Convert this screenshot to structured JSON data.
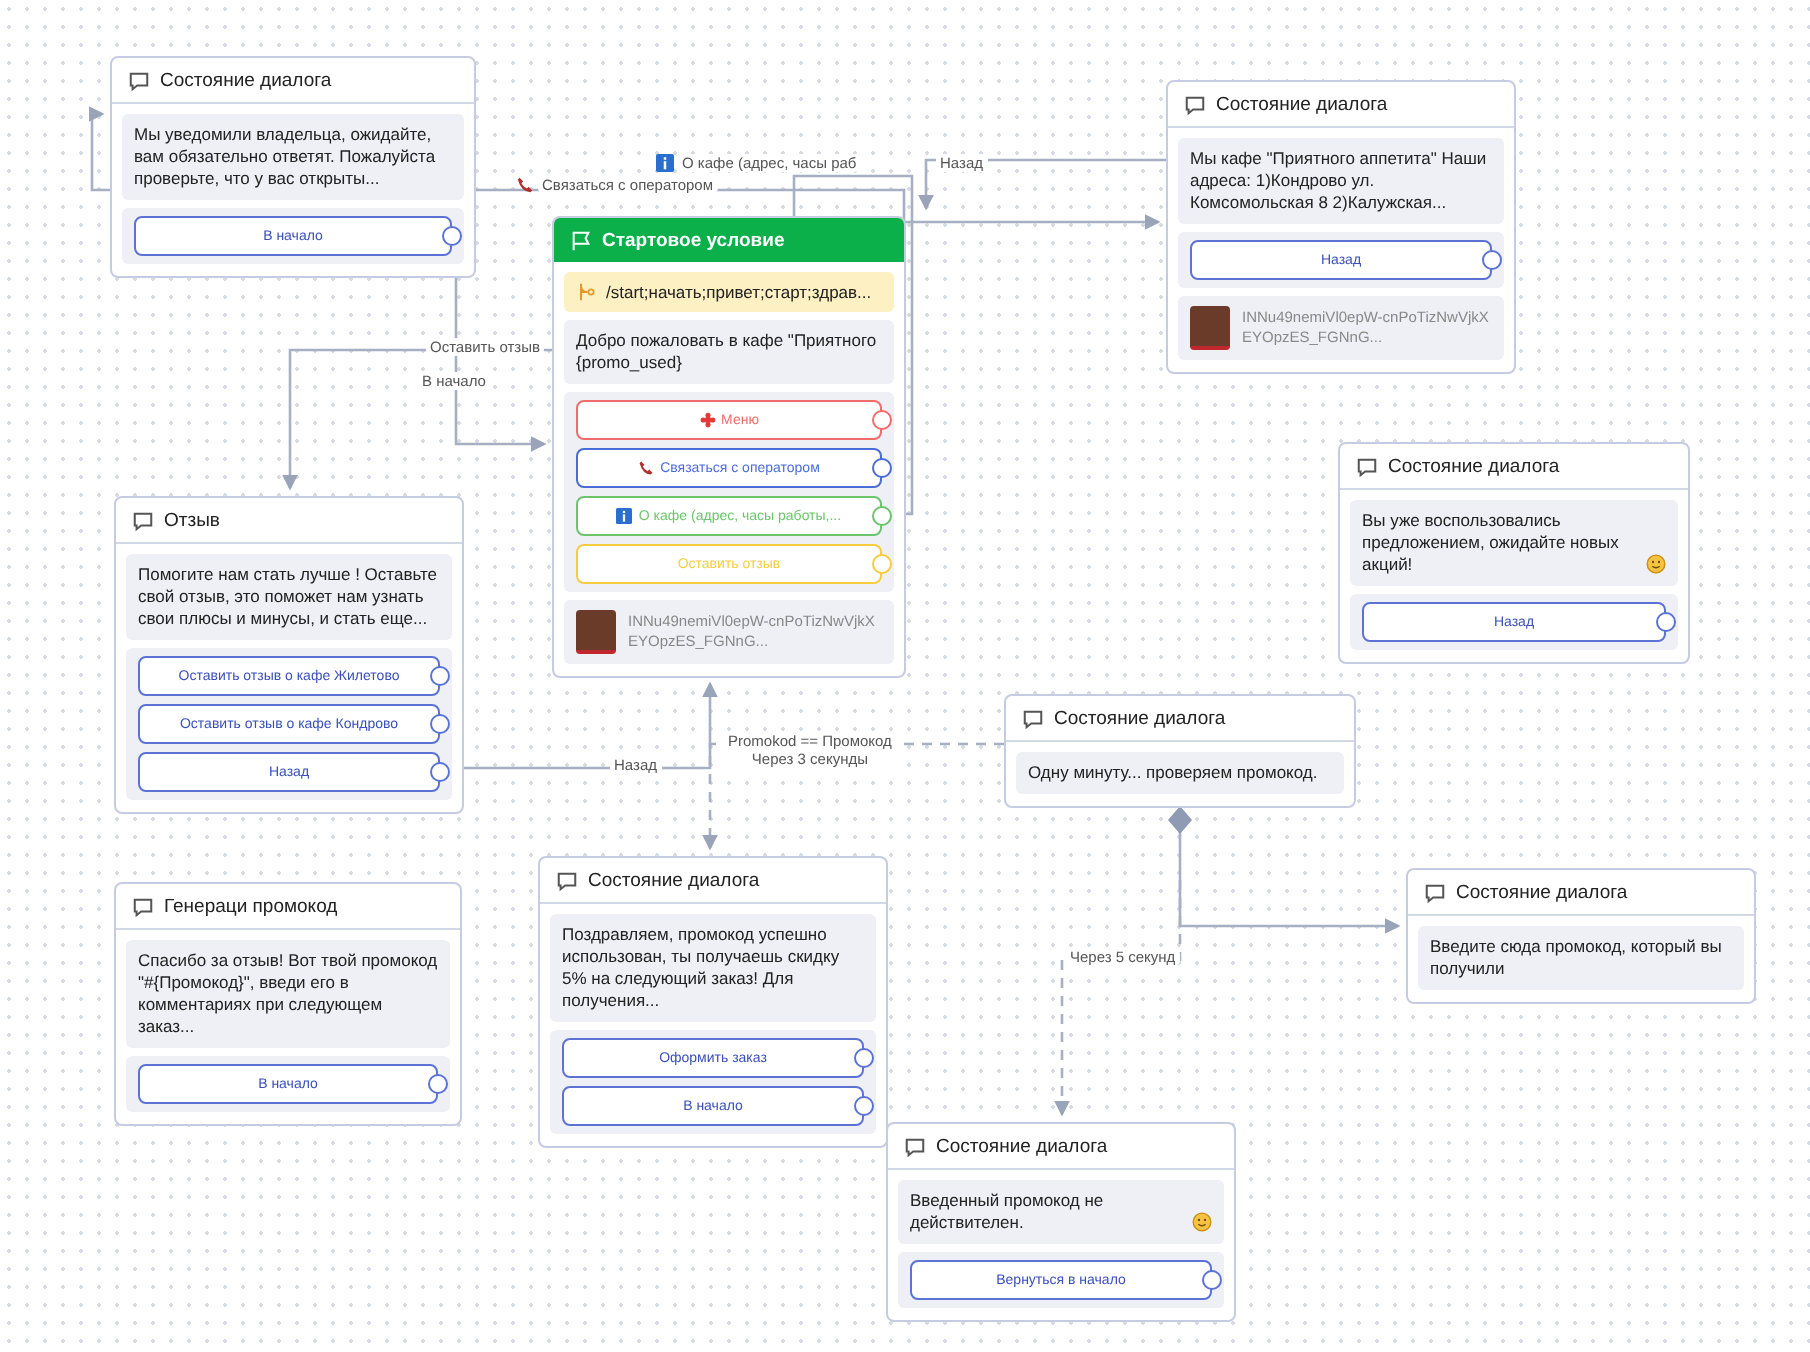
{
  "nodes": [
    {
      "kind": "dialog",
      "title": "Состояние диалога",
      "message": "Мы уведомили владельца, ожидайте, вам обязательно ответят. Пожалуйста проверьте, что у вас открыты...",
      "emoji": false,
      "buttons": [
        {
          "label": "В начало"
        }
      ]
    },
    {
      "kind": "start",
      "title": "Стартовое условие",
      "trigger": "/start;начать;привет;старт;здрав...",
      "message": "Добро пожаловать в кафе \"Приятного {promo_used}",
      "emoji": false,
      "buttons": [
        {
          "label": "Меню",
          "color": "#f26b6b"
        },
        {
          "label": "Связаться с оператором",
          "color": "#4a6cd6"
        },
        {
          "label": "О кафе (адрес, часы работы,...",
          "color": "#6cc56c"
        },
        {
          "label": "Оставить отзыв",
          "color": "#f7cd3f"
        }
      ],
      "media": "INNu49nemiVl0epW-cnPoTizNwVjkXEYOpzES_FGNnG..."
    },
    {
      "kind": "dialog",
      "title": "Состояние диалога",
      "message": "Мы кафе \"Приятного аппетита\" Наши адреса: 1)Кондрово ул. Комсомольская 8 2)Калужская...",
      "emoji": false,
      "buttons": [
        {
          "label": "Назад"
        }
      ],
      "media": "INNu49nemiVl0epW-cnPoTizNwVjkXEYOpzES_FGNnG..."
    },
    {
      "kind": "dialog",
      "title": "Состояние диалога",
      "message": "Вы уже воспользовались предложением, ожидайте новых акций!",
      "emoji": true,
      "buttons": [
        {
          "label": "Назад"
        }
      ]
    },
    {
      "kind": "dialog",
      "title": "Отзыв",
      "message": "Помогите нам стать лучше ! Оставьте свой отзыв, это поможет нам узнать свои плюсы и минусы, и стать еще...",
      "emoji": false,
      "buttons": [
        {
          "label": "Оставить отзыв о кафе Жилетово"
        },
        {
          "label": "Оставить отзыв о кафе Кондрово"
        },
        {
          "label": "Назад"
        }
      ]
    },
    {
      "kind": "dialog",
      "title": "Состояние диалога",
      "message": "Одну минуту... проверяем промокод.",
      "emoji": false
    },
    {
      "kind": "dialog",
      "title": "Генераци промокод",
      "message": "Спасибо за отзыв! Вот твой промокод \"#{Промокод}\", введи его в комментариях при следующем заказ...",
      "emoji": false,
      "buttons": [
        {
          "label": "В начало"
        }
      ]
    },
    {
      "kind": "dialog",
      "title": "Состояние диалога",
      "message": "Поздравляем, промокод успешно использован, ты получаешь скидку 5% на следующий заказ! Для получения...",
      "emoji": false,
      "buttons": [
        {
          "label": "Оформить заказ"
        },
        {
          "label": "В начало"
        }
      ]
    },
    {
      "kind": "dialog",
      "title": "Состояние диалога",
      "message": "Введите сюда промокод, который вы получили",
      "emoji": false
    },
    {
      "kind": "dialog",
      "title": "Состояние диалога",
      "message": "Введенный промокод не действителен.",
      "emoji": true,
      "buttons": [
        {
          "label": "Вернуться в начало"
        }
      ]
    }
  ],
  "edge_labels": [
    {
      "text": "Связаться с оператором"
    },
    {
      "text": "О кафе (адрес, часы раб"
    },
    {
      "text": "Назад"
    },
    {
      "text": "Оставить отзыв"
    },
    {
      "text": "В начало"
    },
    {
      "text": "Назад"
    },
    {
      "text": "Promokod == Промокод\nЧерез 3 секунды"
    },
    {
      "text": "Через 5 секунд"
    }
  ]
}
